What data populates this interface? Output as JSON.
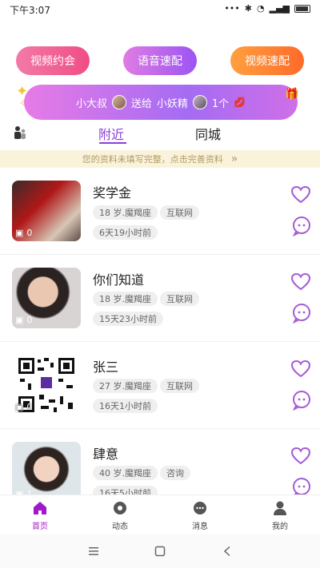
{
  "status_bar": {
    "time": "下午3:07"
  },
  "actions": {
    "video_date": "视频约会",
    "voice_match": "语音速配",
    "video_match": "视频速配"
  },
  "gift_banner": {
    "sender": "小大叔",
    "verb": "送给",
    "receiver": "小妖精",
    "count": "1个"
  },
  "tabs": {
    "nearby": "附近",
    "same_city": "同城"
  },
  "notice": {
    "text": "您的资料未填写完整，点击完善资料",
    "arrow": "»"
  },
  "users": [
    {
      "name": "奖学金",
      "age": "18 岁.魔羯座",
      "industry": "互联网",
      "last_seen": "6天19小时前",
      "photos": "0"
    },
    {
      "name": "你们知道",
      "age": "18 岁.魔羯座",
      "industry": "互联网",
      "last_seen": "15天23小时前",
      "photos": "0"
    },
    {
      "name": "张三",
      "age": "27 岁.魔羯座",
      "industry": "互联网",
      "last_seen": "16天1小时前",
      "photos": "0"
    },
    {
      "name": "肆意",
      "age": "40 岁.魔羯座",
      "industry": "咨询",
      "last_seen": "16天5小时前",
      "photos": "1"
    }
  ],
  "bottom_nav": {
    "home": "首页",
    "moments": "动态",
    "messages": "消息",
    "mine": "我的"
  },
  "colors": {
    "accent": "#8a40d8",
    "nav_active": "#a018c8",
    "heart": "#a55ad6"
  }
}
